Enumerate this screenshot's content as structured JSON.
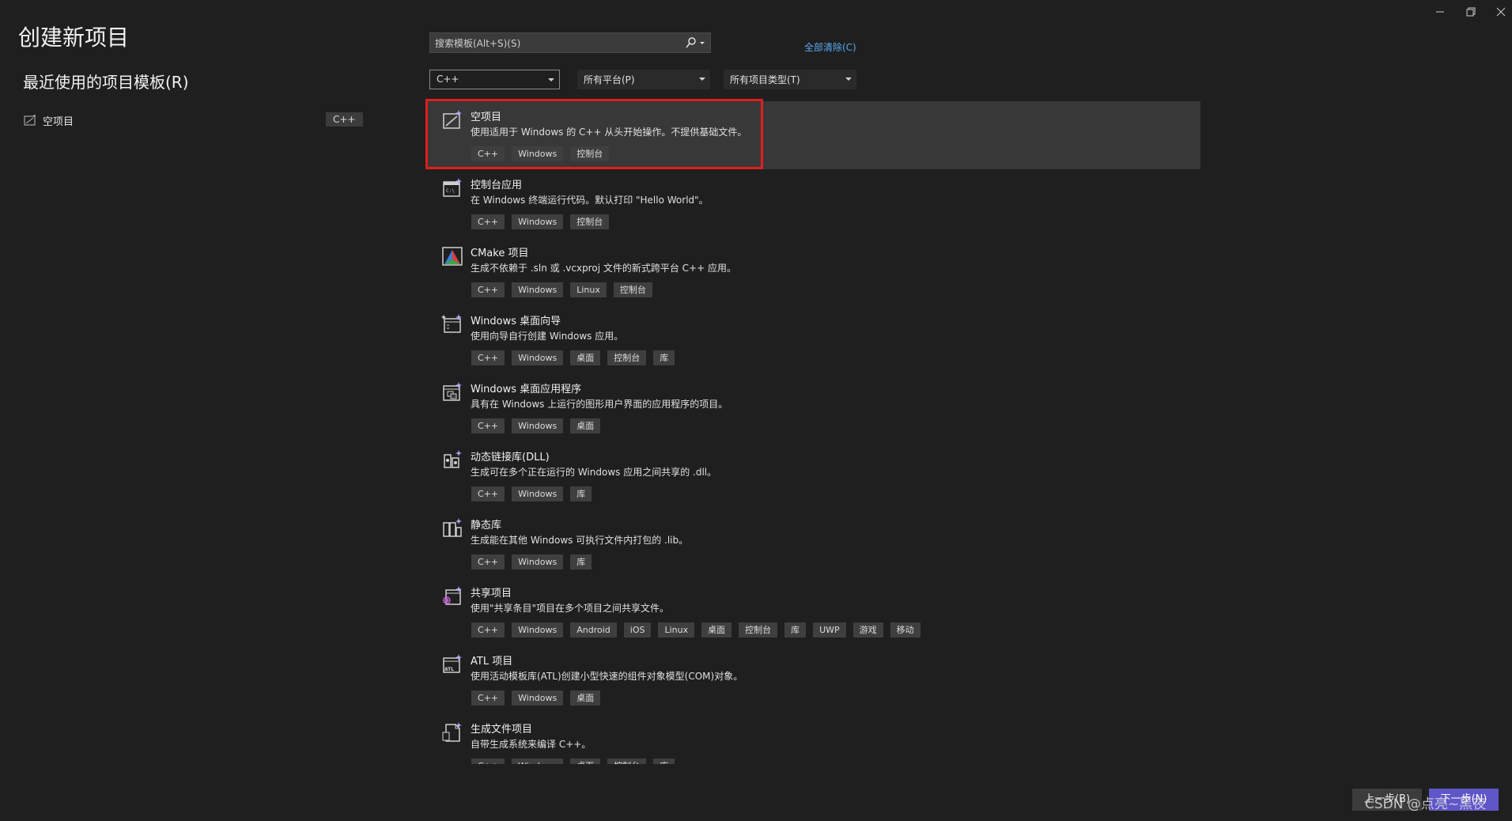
{
  "header": {
    "title": "创建新项目",
    "recent_title": "最近使用的项目模板(R)"
  },
  "recent": {
    "items": [
      {
        "label": "空项目",
        "tag": "C++"
      }
    ]
  },
  "search": {
    "placeholder": "搜索模板(Alt+S)(S)",
    "clear_all": "全部清除(C)"
  },
  "filters": {
    "language": "C++",
    "platform": "所有平台(P)",
    "project_type": "所有项目类型(T)"
  },
  "templates": [
    {
      "name": "空项目",
      "description": "使用适用于 Windows 的 C++ 从头开始操作。不提供基础文件。",
      "tags": [
        "C++",
        "Windows",
        "控制台"
      ],
      "icon": "empty-project-icon",
      "selected": true
    },
    {
      "name": "控制台应用",
      "description": "在 Windows 终端运行代码。默认打印 \"Hello World\"。",
      "tags": [
        "C++",
        "Windows",
        "控制台"
      ],
      "icon": "console-app-icon"
    },
    {
      "name": "CMake 项目",
      "description": "生成不依赖于 .sln 或 .vcxproj 文件的新式跨平台 C++ 应用。",
      "tags": [
        "C++",
        "Windows",
        "Linux",
        "控制台"
      ],
      "icon": "cmake-icon"
    },
    {
      "name": "Windows 桌面向导",
      "description": "使用向导自行创建 Windows 应用。",
      "tags": [
        "C++",
        "Windows",
        "桌面",
        "控制台",
        "库"
      ],
      "icon": "desktop-wizard-icon"
    },
    {
      "name": "Windows 桌面应用程序",
      "description": "具有在 Windows 上运行的图形用户界面的应用程序的项目。",
      "tags": [
        "C++",
        "Windows",
        "桌面"
      ],
      "icon": "desktop-app-icon"
    },
    {
      "name": "动态链接库(DLL)",
      "description": "生成可在多个正在运行的 Windows 应用之间共享的 .dll。",
      "tags": [
        "C++",
        "Windows",
        "库"
      ],
      "icon": "dll-icon"
    },
    {
      "name": "静态库",
      "description": "生成能在其他 Windows 可执行文件内打包的 .lib。",
      "tags": [
        "C++",
        "Windows",
        "库"
      ],
      "icon": "static-lib-icon"
    },
    {
      "name": "共享项目",
      "description": "使用\"共享条目\"项目在多个项目之间共享文件。",
      "tags": [
        "C++",
        "Windows",
        "Android",
        "iOS",
        "Linux",
        "桌面",
        "控制台",
        "库",
        "UWP",
        "游戏",
        "移动"
      ],
      "icon": "shared-project-icon"
    },
    {
      "name": "ATL 项目",
      "description": "使用活动模板库(ATL)创建小型快速的组件对象模型(COM)对象。",
      "tags": [
        "C++",
        "Windows",
        "桌面"
      ],
      "icon": "atl-project-icon"
    },
    {
      "name": "生成文件项目",
      "description": "自带生成系统来编译 C++。",
      "tags": [
        "C++",
        "Windows",
        "桌面",
        "控制台",
        "库"
      ],
      "icon": "makefile-project-icon"
    }
  ],
  "footer": {
    "back": "上一步(B)",
    "next": "下一步(N)",
    "watermark": "CSDN @点亮~黑夜"
  },
  "colors": {
    "background": "#1f1f1f",
    "selected_row": "#383838",
    "highlight": "#e01e1e",
    "link": "#5aa8f2",
    "primary_button": "#5f56c8"
  }
}
